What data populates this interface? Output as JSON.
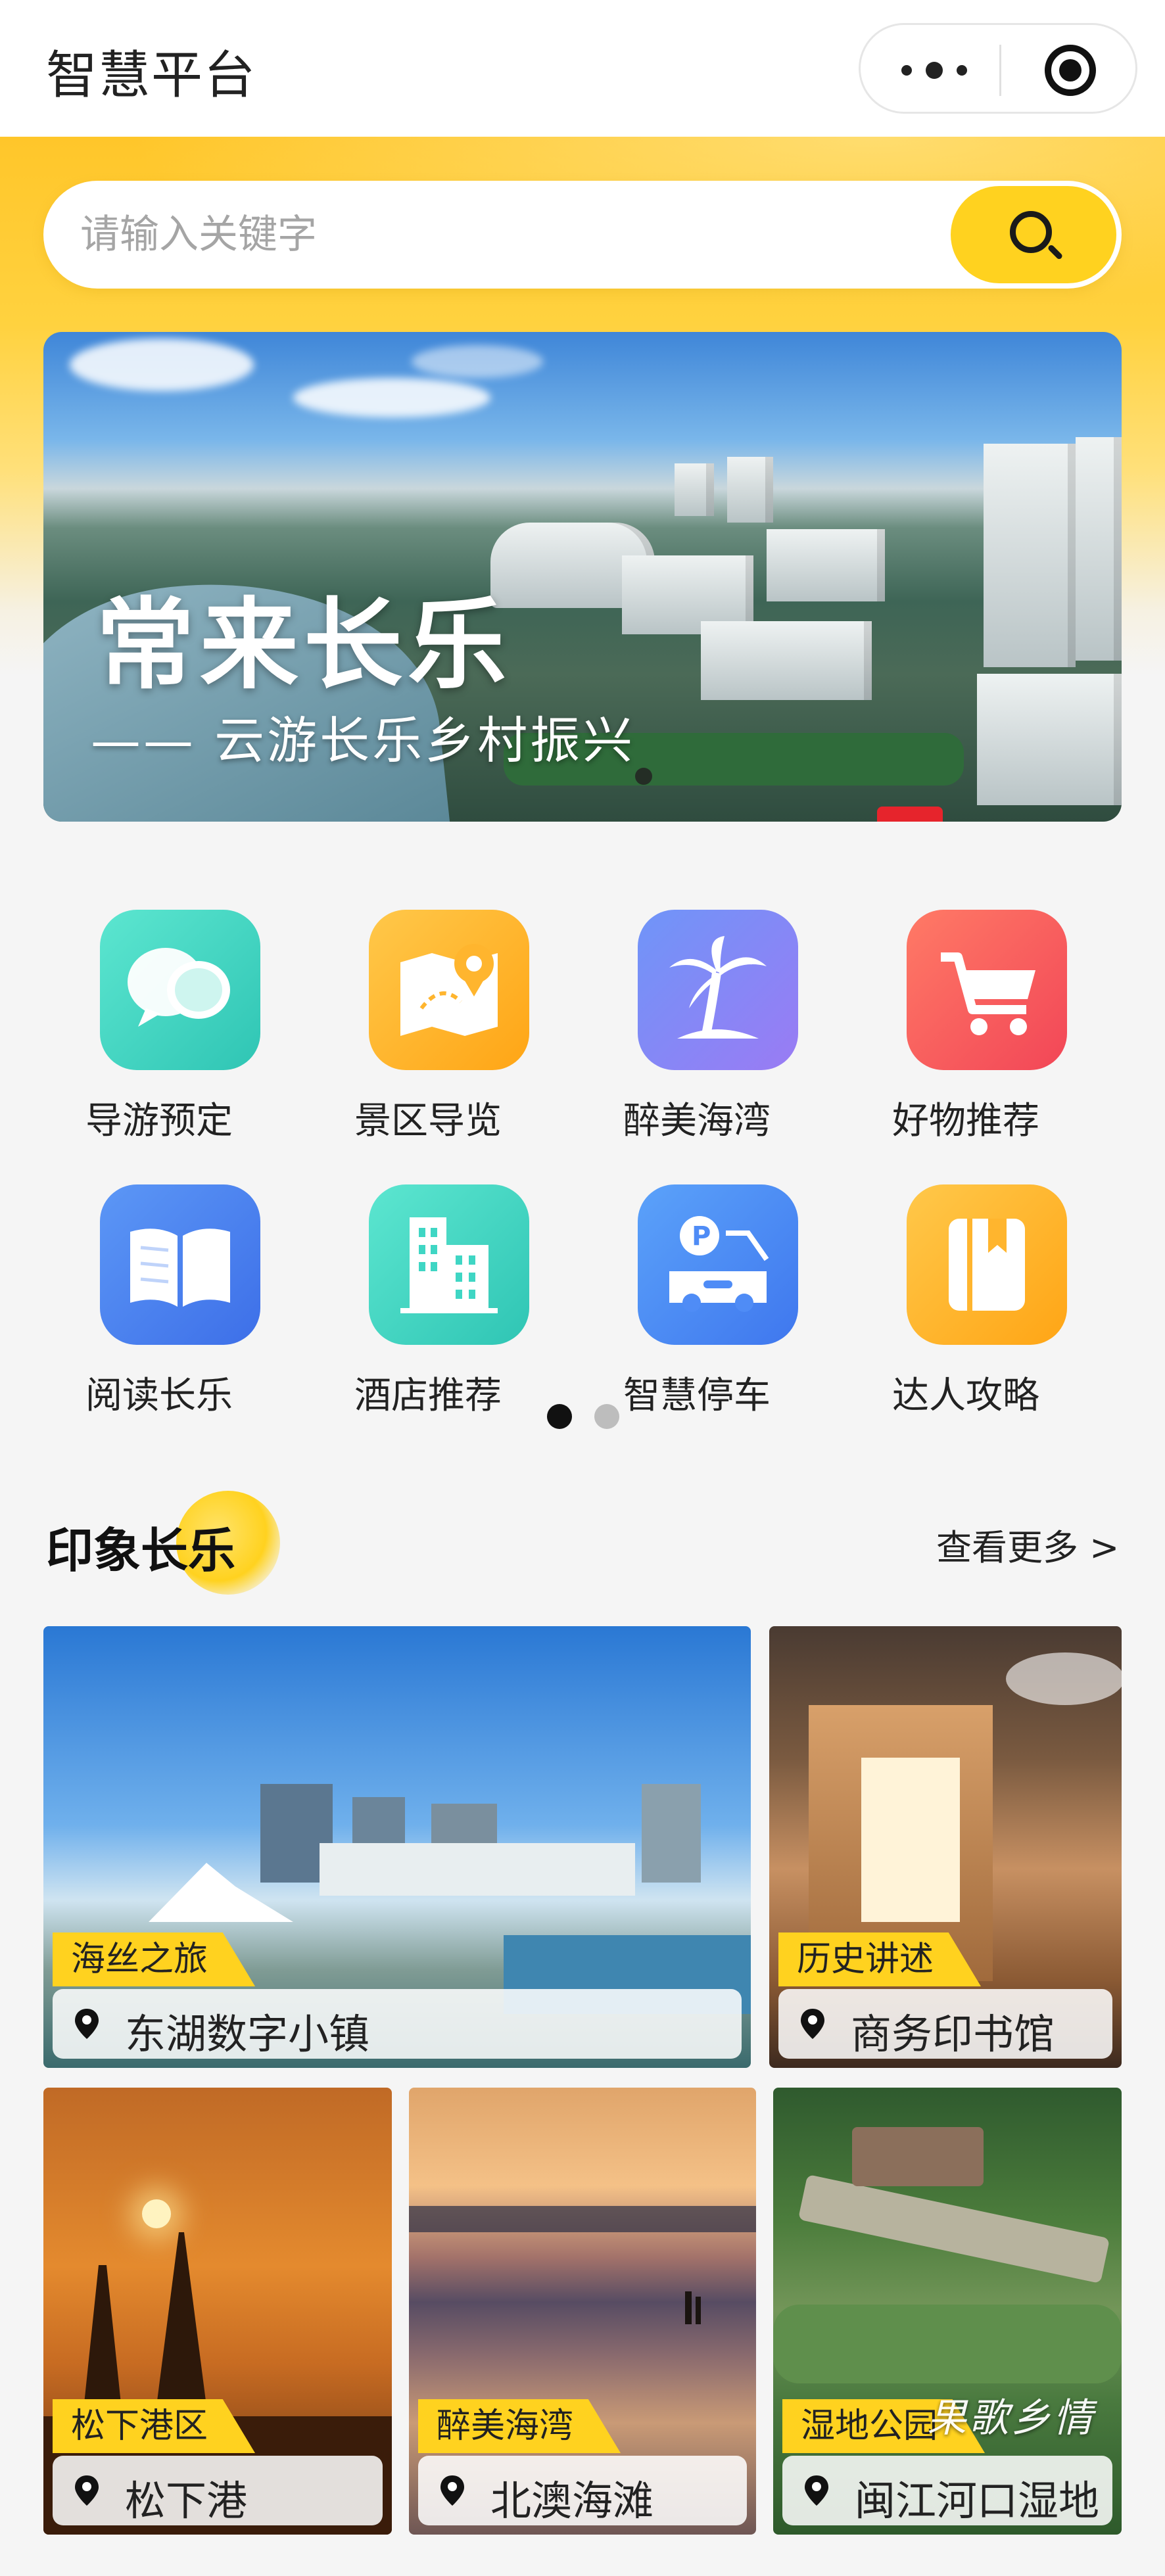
{
  "app": {
    "title": "智慧平台"
  },
  "search": {
    "placeholder": "请输入关键字"
  },
  "banner": {
    "title": "常来长乐",
    "subtitle": "—— 云游长乐乡村振兴"
  },
  "grid": {
    "items": [
      {
        "label": "导游预定",
        "icon": "chat-bubbles-icon",
        "color": "#3dd8c0"
      },
      {
        "label": "景区导览",
        "icon": "map-pin-icon",
        "color": "#ffb52e"
      },
      {
        "label": "醉美海湾",
        "icon": "palm-tree-icon",
        "color": "#7d86f7"
      },
      {
        "label": "好物推荐",
        "icon": "shopping-cart-icon",
        "color": "#f8595e"
      },
      {
        "label": "阅读长乐",
        "icon": "open-book-icon",
        "color": "#4b82f2"
      },
      {
        "label": "酒店推荐",
        "icon": "building-icon",
        "color": "#3fd6c4"
      },
      {
        "label": "智慧停车",
        "icon": "parking-car-icon",
        "color": "#4f8cf6"
      },
      {
        "label": "达人攻略",
        "icon": "notebook-icon",
        "color": "#ffb52e"
      }
    ]
  },
  "section": {
    "title": "印象长乐",
    "more": "查看更多 >"
  },
  "cards": [
    {
      "tag": "海丝之旅",
      "name": "东湖数字小镇"
    },
    {
      "tag": "历史讲述",
      "name": "商务印书馆"
    },
    {
      "tag": "松下港区",
      "name": "松下港"
    },
    {
      "tag": "醉美海湾",
      "name": "北澳海滩"
    },
    {
      "tag": "湿地公园",
      "name": "闽江河口湿地"
    }
  ],
  "watermark": "果歌乡情"
}
